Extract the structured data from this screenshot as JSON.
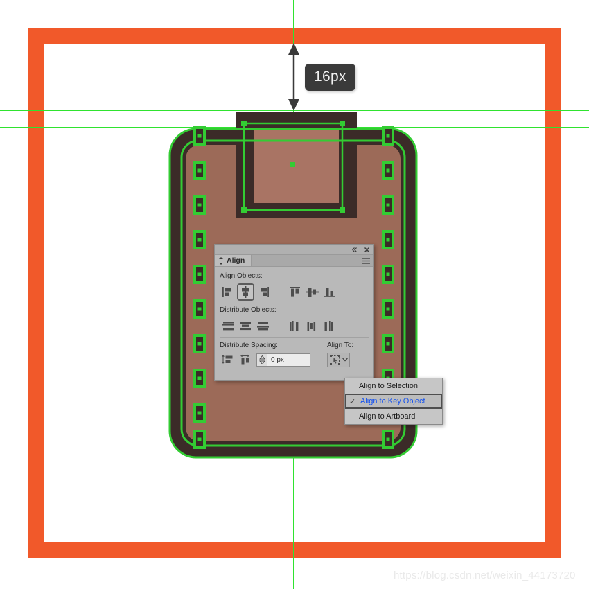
{
  "canvas": {
    "background": "#ffffff",
    "artboard_frame_color": "#f1592a",
    "guide_color": "#2fe32f",
    "selection_color": "#33cc33"
  },
  "measurement": {
    "value": "16px",
    "icon": "double-arrow-vertical"
  },
  "illustration": {
    "body_fill": "#9c6a58",
    "stroke": "#3b2b28",
    "name": "clipboard-icon-artwork"
  },
  "panel": {
    "title": "Align",
    "collapse_icon": "double-chevron-left-icon",
    "close_icon": "close-icon",
    "menu_icon": "hamburger-menu-icon",
    "tab_icon": "diamond-caret-icon",
    "sections": {
      "align_objects": {
        "label": "Align Objects:",
        "buttons": [
          {
            "name": "horizontal-align-left",
            "selected": false
          },
          {
            "name": "horizontal-align-center",
            "selected": true
          },
          {
            "name": "horizontal-align-right",
            "selected": false
          },
          {
            "name": "vertical-align-top",
            "selected": false
          },
          {
            "name": "vertical-align-center",
            "selected": false
          },
          {
            "name": "vertical-align-bottom",
            "selected": false
          }
        ]
      },
      "distribute_objects": {
        "label": "Distribute Objects:",
        "buttons": [
          {
            "name": "vertical-distribute-top",
            "selected": false
          },
          {
            "name": "vertical-distribute-center",
            "selected": false
          },
          {
            "name": "vertical-distribute-bottom",
            "selected": false
          },
          {
            "name": "horizontal-distribute-left",
            "selected": false
          },
          {
            "name": "horizontal-distribute-center",
            "selected": false
          },
          {
            "name": "horizontal-distribute-right",
            "selected": false
          }
        ]
      },
      "distribute_spacing": {
        "label": "Distribute Spacing:",
        "buttons": [
          {
            "name": "vertical-distribute-spacing",
            "selected": false
          },
          {
            "name": "horizontal-distribute-spacing",
            "selected": false
          }
        ],
        "spacing_value": "0 px",
        "spacing_placeholder": "0 px"
      },
      "align_to": {
        "label": "Align To:",
        "button_icon": "align-to-key-object-icon",
        "chevron": "chevron-down-icon"
      }
    }
  },
  "align_menu": {
    "items": [
      {
        "label": "Align to Selection",
        "checked": false
      },
      {
        "label": "Align to Key Object",
        "checked": true
      },
      {
        "label": "Align to Artboard",
        "checked": false
      }
    ],
    "check_glyph": "✓",
    "highlight_color": "#1452f0"
  },
  "watermark": {
    "text": "https://blog.csdn.net/weixin_44173720"
  }
}
